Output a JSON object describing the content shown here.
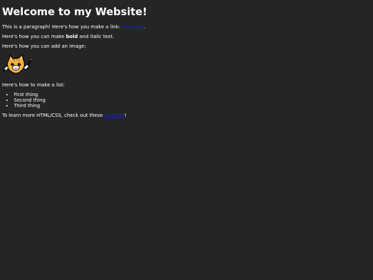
{
  "page": {
    "heading": "Welcome to my Website!",
    "link_paragraph": {
      "before": "This is a paragraph! Here's how you make a link: ",
      "link_text": "Neocities",
      "after": "."
    },
    "format_paragraph": {
      "before": "Here's how you can make ",
      "bold": "bold",
      "middle": " and ",
      "italic": "italic",
      "after": " text."
    },
    "image_paragraph": "Here's how you can add an image:",
    "image": {
      "icon": "neocities-cat-icon"
    },
    "list_intro": "Here's how to make a list:",
    "list_items": [
      "First thing",
      "Second thing",
      "Third thing"
    ],
    "resources_paragraph": {
      "before": "To learn more HTML/CSS, check out these ",
      "link_text": "tutorials",
      "after": "!"
    }
  },
  "colors": {
    "background": "#252525",
    "text": "#ffffff",
    "link": "#1a1ad6"
  }
}
